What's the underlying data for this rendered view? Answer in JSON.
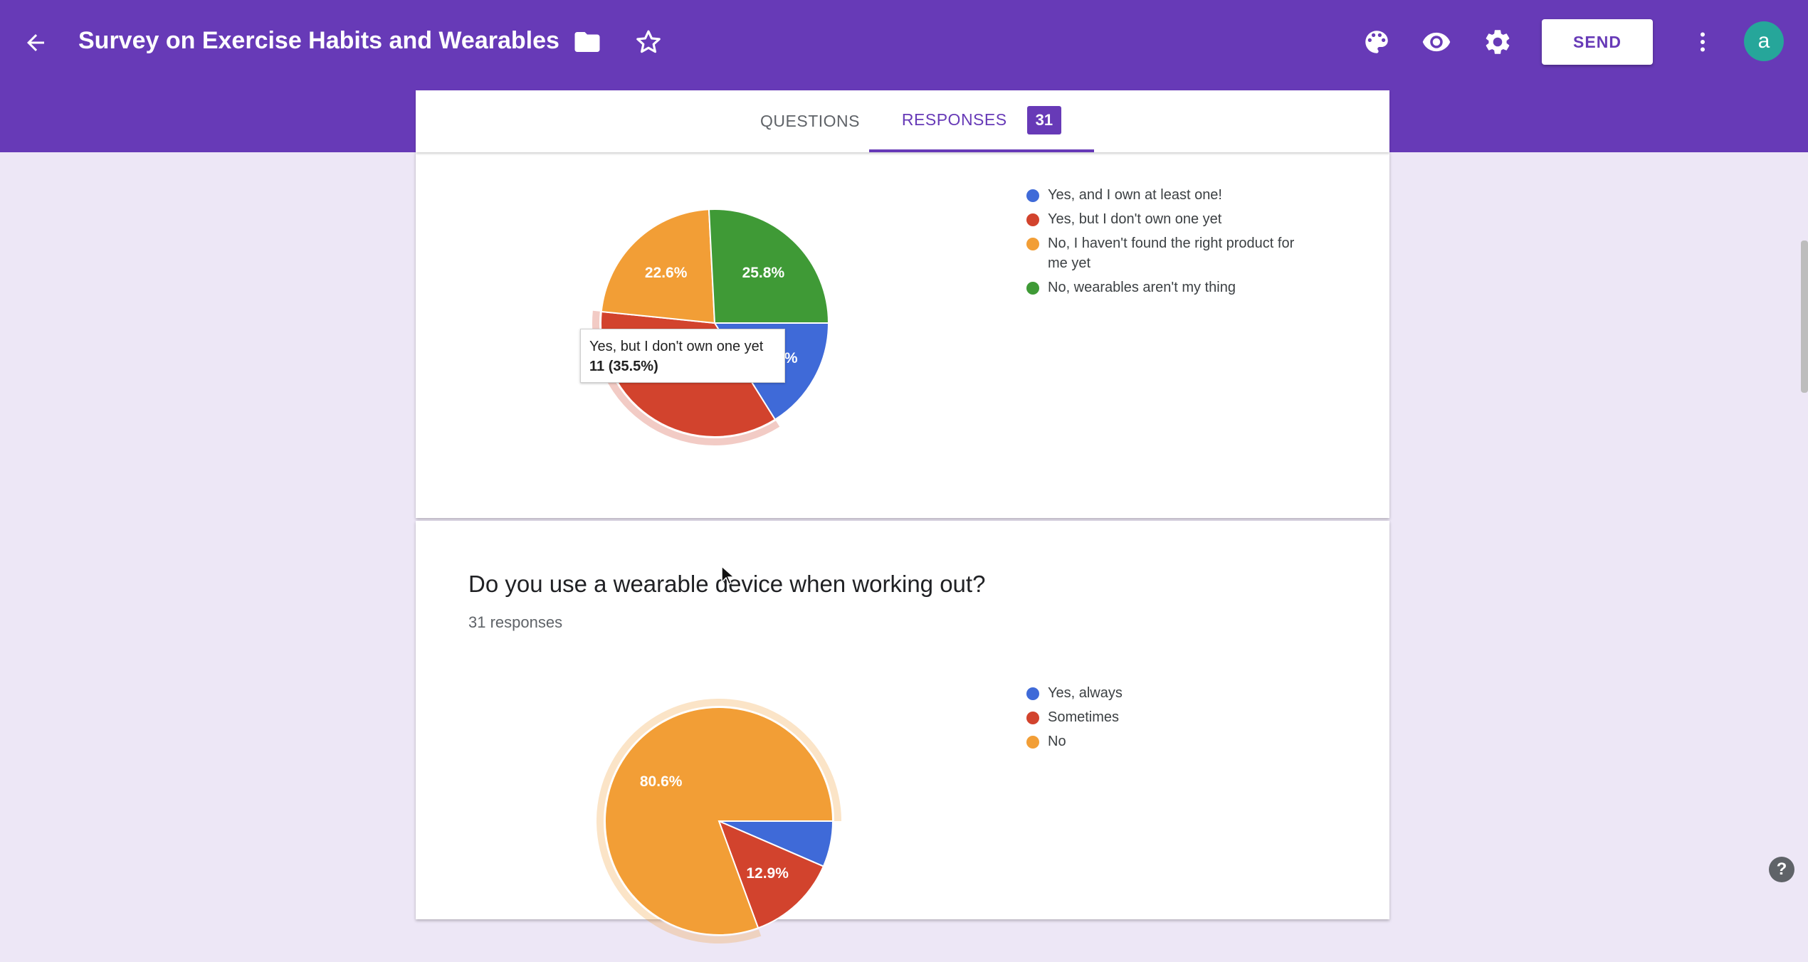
{
  "header": {
    "title": "Survey on Exercise Habits and Wearables",
    "send_label": "SEND",
    "avatar_letter": "a",
    "icons": [
      "back-arrow-icon",
      "folder-icon",
      "star-icon",
      "palette-icon",
      "eye-icon",
      "gear-icon",
      "more-vert-icon"
    ]
  },
  "tabs": {
    "questions_label": "QUESTIONS",
    "responses_label": "RESPONSES",
    "responses_count": "31"
  },
  "colors": {
    "primary": "#673ab7",
    "background": "#ede7f6",
    "blue": "#3f6ad8",
    "red": "#d2432d",
    "orange": "#f29e36",
    "green": "#3f9a36"
  },
  "question1": {
    "legend": [
      {
        "label": "Yes, and I own at least one!",
        "color": "#3f6ad8"
      },
      {
        "label": "Yes, but I don't own one yet",
        "color": "#d2432d"
      },
      {
        "label": "No, I haven't found the right product for me yet",
        "color": "#f29e36"
      },
      {
        "label": "No, wearables aren't my thing",
        "color": "#3f9a36"
      }
    ],
    "tooltip": {
      "label": "Yes, but I don't own one yet",
      "value": "11 (35.5%)"
    }
  },
  "question2": {
    "title": "Do you use a wearable device when working out?",
    "responses": "31 responses",
    "legend": [
      {
        "label": "Yes, always",
        "color": "#3f6ad8"
      },
      {
        "label": "Sometimes",
        "color": "#d2432d"
      },
      {
        "label": "No",
        "color": "#f29e36"
      }
    ]
  },
  "chart_data": [
    {
      "type": "pie",
      "title": "",
      "categories": [
        "Yes, and I own at least one!",
        "Yes, but I don't own one yet",
        "No, I haven't found the right product for me yet",
        "No, wearables aren't my thing"
      ],
      "values": [
        16.1,
        35.5,
        22.6,
        25.8
      ],
      "data_labels": [
        "16.1%",
        "",
        "22.6%",
        "25.8%"
      ],
      "highlighted": "Yes, but I don't own one yet",
      "legend": "right"
    },
    {
      "type": "pie",
      "title": "Do you use a wearable device when working out?",
      "categories": [
        "Yes, always",
        "Sometimes",
        "No"
      ],
      "values": [
        6.5,
        12.9,
        80.6
      ],
      "data_labels": [
        "",
        "12.9%",
        "80.6%"
      ],
      "highlighted": "No",
      "legend": "right"
    }
  ],
  "help_label": "?"
}
